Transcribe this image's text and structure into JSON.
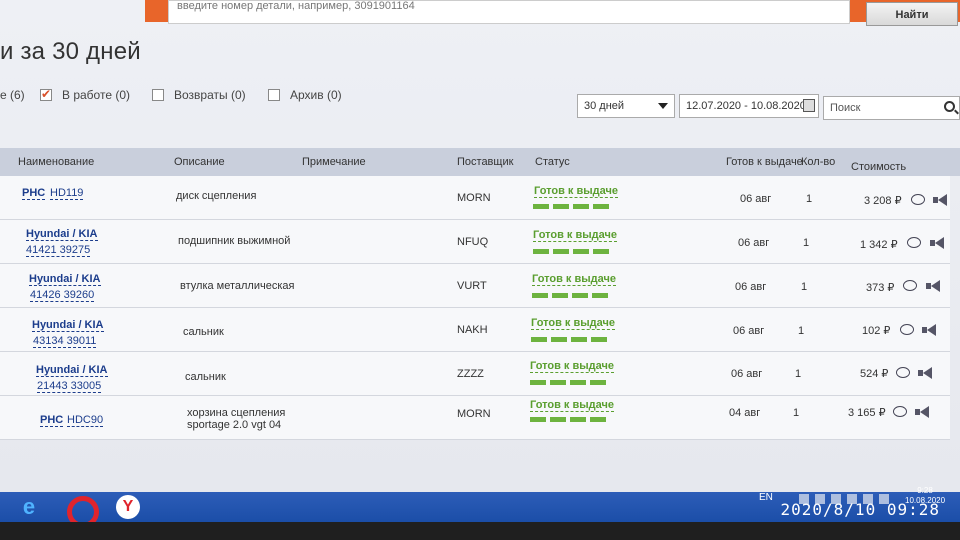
{
  "header": {
    "search_placeholder": "введите номер детали, например, 3091901164",
    "search_button": "Найти"
  },
  "page_title": "и за 30 дней",
  "filters": [
    {
      "label": "е (6)",
      "checked": false,
      "partial": true
    },
    {
      "label": "В работе (0)",
      "checked": true
    },
    {
      "label": "Возвраты (0)",
      "checked": false
    },
    {
      "label": "Архив (0)",
      "checked": false
    }
  ],
  "period_select": "30 дней",
  "date_range": "12.07.2020 - 10.08.2020",
  "search_placeholder": "Поиск",
  "table": {
    "headers": {
      "name": "Наименование",
      "description": "Описание",
      "note": "Примечание",
      "supplier": "Поставщик",
      "status": "Статус",
      "ready": "Готов к выдаче",
      "qty": "Кол-во",
      "cost": "Стоимость"
    },
    "rows": [
      {
        "brand": "PHC",
        "code": "HD119",
        "desc": "диск сцепления",
        "desc2": "",
        "supplier": "MORN",
        "status": "Готов к выдаче",
        "date": "06 авг",
        "qty": "1",
        "cost": "3 208 ₽"
      },
      {
        "brand": "Hyundai / KIA",
        "code": "41421 39275",
        "desc": "подшипник выжимной",
        "desc2": "",
        "supplier": "NFUQ",
        "status": "Готов к выдаче",
        "date": "06 авг",
        "qty": "1",
        "cost": "1 342 ₽"
      },
      {
        "brand": "Hyundai / KIA",
        "code": "41426 39260",
        "desc": "втулка металлическая",
        "desc2": "",
        "supplier": "VURT",
        "status": "Готов к выдаче",
        "date": "06 авг",
        "qty": "1",
        "cost": "373 ₽"
      },
      {
        "brand": "Hyundai / KIA",
        "code": "43134 39011",
        "desc": "сальник",
        "desc2": "",
        "supplier": "NAKH",
        "status": "Готов к выдаче",
        "date": "06 авг",
        "qty": "1",
        "cost": "102 ₽"
      },
      {
        "brand": "Hyundai / KIA",
        "code": "21443 33005",
        "desc": "сальник",
        "desc2": "",
        "supplier": "ZZZZ",
        "status": "Готов к выдаче",
        "date": "06 авг",
        "qty": "1",
        "cost": "524 ₽"
      },
      {
        "brand": "PHC",
        "code": "HDC90",
        "desc": "хорзина сцепления",
        "desc2": "sportage 2.0 vgt 04",
        "supplier": "MORN",
        "status": "Готов к выдаче",
        "date": "04 авг",
        "qty": "1",
        "cost": "3 165 ₽"
      }
    ]
  },
  "taskbar": {
    "lang": "EN",
    "clock_time": "9:28",
    "clock_date": "10.08.2020"
  },
  "photo_timestamp": "2020/8/10  09:28"
}
